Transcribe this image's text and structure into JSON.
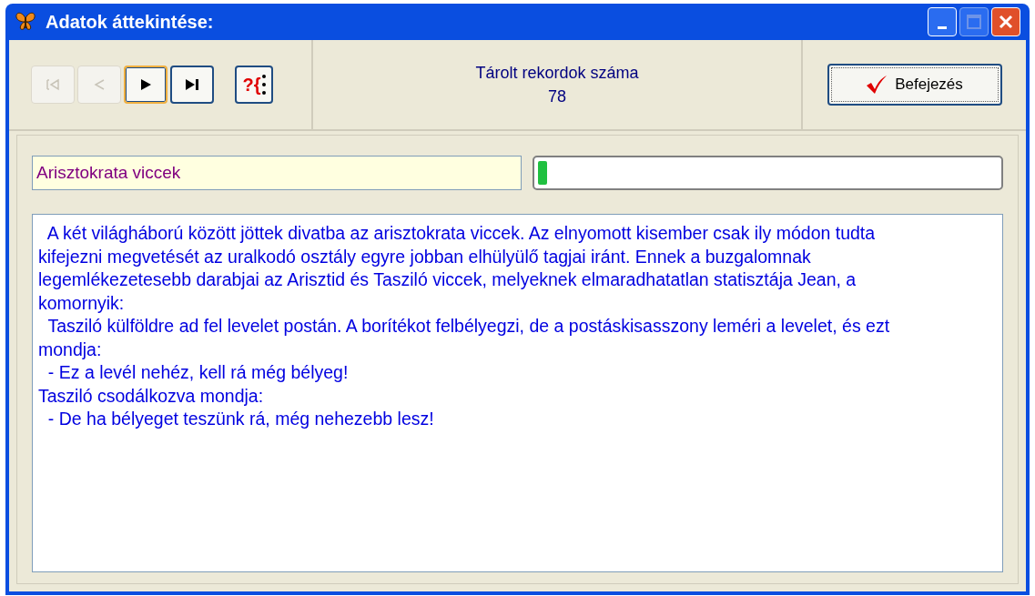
{
  "window": {
    "title": "Adatok áttekintése:"
  },
  "nav_buttons": [
    {
      "kind": "first",
      "disabled": true,
      "focused": false
    },
    {
      "kind": "prev",
      "disabled": true,
      "focused": false
    },
    {
      "kind": "next",
      "disabled": false,
      "focused": true
    },
    {
      "kind": "last",
      "disabled": false,
      "focused": false
    }
  ],
  "help_button": {
    "label": "?{"
  },
  "record_count": {
    "label": "Tárolt rekordok száma",
    "value": "78"
  },
  "finish_button": {
    "label": "Befejezés"
  },
  "title_field": {
    "value": "Arisztokrata viccek"
  },
  "progress": {
    "level": 0.02
  },
  "text_lines": [
    "  A két világháború között jöttek divatba az arisztokrata viccek. Az elnyomott kisember csak ily módon tudta",
    "kifejezni megvetését az uralkodó osztály egyre jobban elhülyülő tagjai iránt. Ennek a buzgalomnak",
    "legemlékezetesebb darabjai az Arisztid és Tasziló viccek, melyeknek elmaradhatatlan statisztája Jean, a",
    "komornyik:",
    "  Tasziló külföldre ad fel levelet postán. A borítékot felbélyegzi, de a postáskisasszony leméri a levelet, és ezt",
    "mondja:",
    "  - Ez a levél nehéz, kell rá még bélyeg!",
    "Tasziló csodálkozva mondja:",
    "  - De ha bélyeget teszünk rá, még nehezebb lesz!"
  ]
}
